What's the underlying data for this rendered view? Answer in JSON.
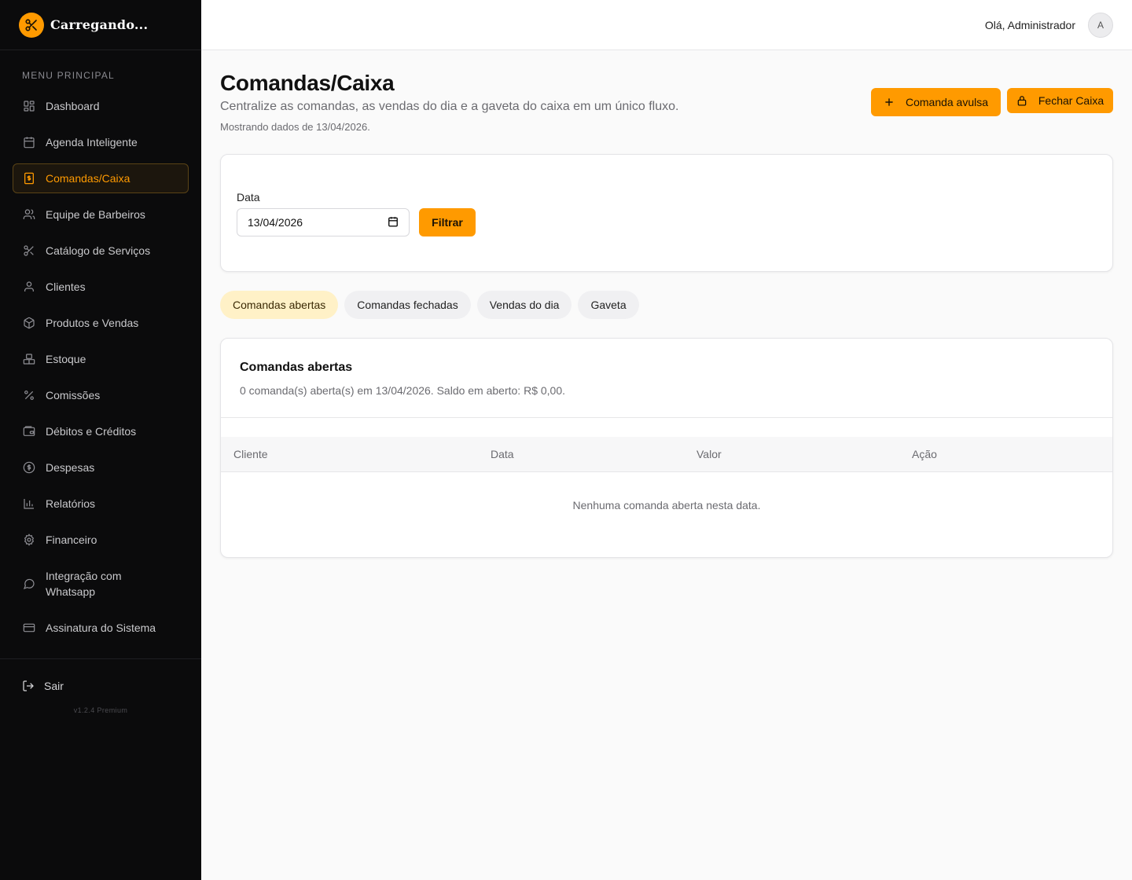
{
  "brand": {
    "name": "Carregando..."
  },
  "sidebar": {
    "heading": "MENU PRINCIPAL",
    "items": [
      {
        "label": "Dashboard",
        "icon": "dashboard-icon"
      },
      {
        "label": "Agenda Inteligente",
        "icon": "calendar-icon"
      },
      {
        "label": "Comandas/Caixa",
        "icon": "receipt-dollar-icon",
        "active": true
      },
      {
        "label": "Equipe de Barbeiros",
        "icon": "users-icon"
      },
      {
        "label": "Catálogo de Serviços",
        "icon": "scissors-icon"
      },
      {
        "label": "Clientes",
        "icon": "user-icon"
      },
      {
        "label": "Produtos e Vendas",
        "icon": "package-icon"
      },
      {
        "label": "Estoque",
        "icon": "boxes-icon"
      },
      {
        "label": "Comissões",
        "icon": "percent-icon"
      },
      {
        "label": "Débitos e Créditos",
        "icon": "wallet-icon"
      },
      {
        "label": "Despesas",
        "icon": "dollar-circle-icon"
      },
      {
        "label": "Relatórios",
        "icon": "bar-chart-icon"
      },
      {
        "label": "Financeiro",
        "icon": "gear-icon"
      },
      {
        "label": "Integração com Whatsapp",
        "icon": "message-circle-icon"
      },
      {
        "label": "Assinatura do Sistema",
        "icon": "credit-card-icon"
      }
    ],
    "logout": "Sair",
    "version": "v1.2.4 Premium"
  },
  "topbar": {
    "greeting": "Olá, Administrador",
    "avatar": "A"
  },
  "page": {
    "title": "Comandas/Caixa",
    "subtitle": "Centralize as comandas, as vendas do dia e a gaveta do caixa em um único fluxo.",
    "date_info": "Mostrando dados de 13/04/2026.",
    "btn_avulsa": "Comanda avulsa",
    "btn_fechar": "Fechar Caixa"
  },
  "filter": {
    "label": "Data",
    "value": "13/04/2026",
    "button": "Filtrar"
  },
  "tabs": [
    {
      "label": "Comandas abertas",
      "active": true
    },
    {
      "label": "Comandas fechadas"
    },
    {
      "label": "Vendas do dia"
    },
    {
      "label": "Gaveta"
    }
  ],
  "list": {
    "title": "Comandas abertas",
    "description": "0 comanda(s) aberta(s) em 13/04/2026. Saldo em aberto: R$ 0,00.",
    "columns": [
      "Cliente",
      "Data",
      "Valor",
      "Ação"
    ],
    "empty": "Nenhuma comanda aberta nesta data."
  },
  "colors": {
    "accent": "#ff9a00",
    "sidebar_bg": "#0b0b0c",
    "tab_active_bg": "#fff1c7"
  }
}
